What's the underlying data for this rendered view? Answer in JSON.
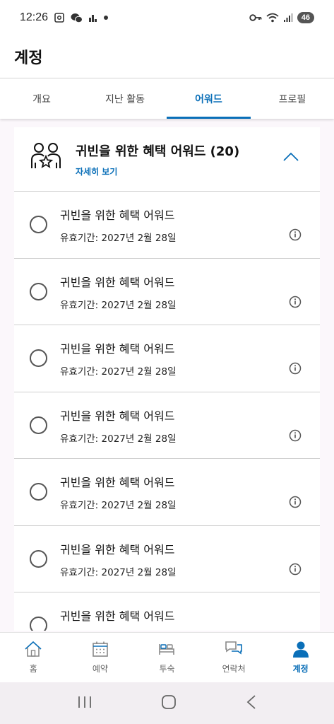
{
  "status_bar": {
    "time": "12:26",
    "battery": "46",
    "left_icons": [
      "screenshot-icon",
      "wechat-icon",
      "chart-icon",
      "dot-icon"
    ],
    "right_icons": [
      "key-icon",
      "wifi-icon",
      "signal-icon"
    ]
  },
  "header": {
    "title": "계정"
  },
  "tabs": [
    {
      "label": "개요",
      "active": false
    },
    {
      "label": "지난 활동",
      "active": false
    },
    {
      "label": "어워드",
      "active": true
    },
    {
      "label": "프로필",
      "active": false
    }
  ],
  "award_group": {
    "title": "귀빈을 위한 혜택 어워드 (20)",
    "details_link": "자세히 보기",
    "icon": "people-star-icon",
    "expanded": true
  },
  "awards": [
    {
      "title": "귀빈을 위한 혜택 어워드",
      "validity": "유효기간: 2027년 2월 28일"
    },
    {
      "title": "귀빈을 위한 혜택 어워드",
      "validity": "유효기간: 2027년 2월 28일"
    },
    {
      "title": "귀빈을 위한 혜택 어워드",
      "validity": "유효기간: 2027년 2월 28일"
    },
    {
      "title": "귀빈을 위한 혜택 어워드",
      "validity": "유효기간: 2027년 2월 28일"
    },
    {
      "title": "귀빈을 위한 혜택 어워드",
      "validity": "유효기간: 2027년 2월 28일"
    },
    {
      "title": "귀빈을 위한 혜택 어워드",
      "validity": "유효기간: 2027년 2월 28일"
    },
    {
      "title": "귀빈을 위한 혜택 어워드",
      "validity": ""
    }
  ],
  "bottom_nav": [
    {
      "label": "홈",
      "icon": "home-icon",
      "active": false
    },
    {
      "label": "예약",
      "icon": "calendar-icon",
      "active": false
    },
    {
      "label": "투숙",
      "icon": "bed-icon",
      "active": false
    },
    {
      "label": "연락처",
      "icon": "chat-icon",
      "active": false
    },
    {
      "label": "계정",
      "icon": "person-icon",
      "active": true
    }
  ],
  "system_nav": [
    "recents-icon",
    "home-circle-icon",
    "back-icon"
  ],
  "colors": {
    "accent": "#0a6fb8",
    "background": "#fbf7fb",
    "divider": "#d0d0d0"
  }
}
